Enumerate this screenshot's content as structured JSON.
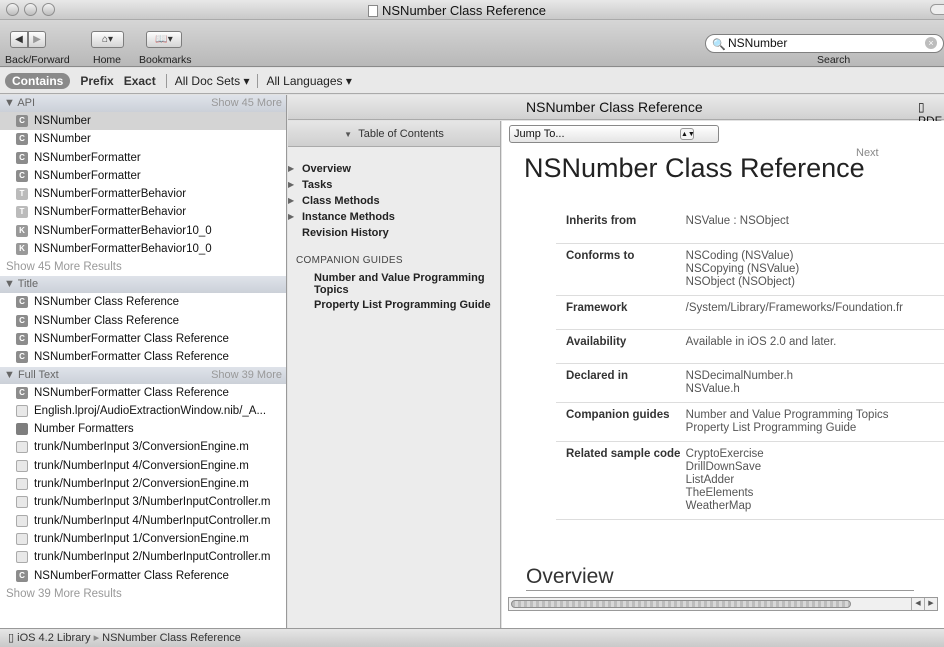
{
  "window": {
    "title": "NSNumber Class Reference"
  },
  "toolbar": {
    "back_forward_label": "Back/Forward",
    "home_label": "Home",
    "bookmarks_label": "Bookmarks",
    "search_value": "NSNumber",
    "search_label": "Search"
  },
  "filter": {
    "contains": "Contains",
    "prefix": "Prefix",
    "exact": "Exact",
    "doc_sets": "All Doc Sets",
    "languages": "All Languages"
  },
  "sidebar": {
    "api": {
      "header": "API",
      "more": "Show 45 More",
      "items": [
        {
          "icon": "C",
          "label": "NSNumber"
        },
        {
          "icon": "C",
          "label": "NSNumber"
        },
        {
          "icon": "C",
          "label": "NSNumberFormatter"
        },
        {
          "icon": "C",
          "label": "NSNumberFormatter"
        },
        {
          "icon": "T",
          "label": "NSNumberFormatterBehavior"
        },
        {
          "icon": "T",
          "label": "NSNumberFormatterBehavior"
        },
        {
          "icon": "K",
          "label": "NSNumberFormatterBehavior10_0"
        },
        {
          "icon": "K",
          "label": "NSNumberFormatterBehavior10_0"
        }
      ],
      "more_results": "Show 45 More Results"
    },
    "title": {
      "header": "Title",
      "items": [
        {
          "icon": "C",
          "label": "NSNumber Class Reference"
        },
        {
          "icon": "C",
          "label": "NSNumber Class Reference"
        },
        {
          "icon": "C",
          "label": "NSNumberFormatter Class Reference"
        },
        {
          "icon": "C",
          "label": "NSNumberFormatter Class Reference"
        }
      ]
    },
    "fulltext": {
      "header": "Full Text",
      "more": "Show 39 More",
      "items": [
        {
          "icon": "C",
          "label": "NSNumberFormatter Class Reference"
        },
        {
          "icon": "F",
          "label": "English.lproj/AudioExtractionWindow.nib/_A..."
        },
        {
          "icon": "B",
          "label": "Number Formatters"
        },
        {
          "icon": "F",
          "label": "trunk/NumberInput 3/ConversionEngine.m"
        },
        {
          "icon": "F",
          "label": "trunk/NumberInput 4/ConversionEngine.m"
        },
        {
          "icon": "F",
          "label": "trunk/NumberInput 2/ConversionEngine.m"
        },
        {
          "icon": "F",
          "label": "trunk/NumberInput 3/NumberInputController.m"
        },
        {
          "icon": "F",
          "label": "trunk/NumberInput 4/NumberInputController.m"
        },
        {
          "icon": "F",
          "label": "trunk/NumberInput 1/ConversionEngine.m"
        },
        {
          "icon": "F",
          "label": "trunk/NumberInput 2/NumberInputController.m"
        },
        {
          "icon": "C",
          "label": "NSNumberFormatter Class Reference"
        }
      ],
      "more_results": "Show 39 More Results"
    }
  },
  "doc": {
    "bar_title": "NSNumber Class Reference",
    "pdf_label": "PDF",
    "jump_to": "Jump To...",
    "title": "NSNumber Class Reference",
    "next": "Next",
    "overview": "Overview",
    "properties": [
      {
        "key": "Inherits from",
        "lines": [
          "NSValue : NSObject"
        ]
      },
      {
        "key": "Conforms to",
        "lines": [
          "NSCoding (NSValue)",
          "NSCopying (NSValue)",
          "NSObject (NSObject)"
        ]
      },
      {
        "key": "Framework",
        "lines": [
          "/System/Library/Frameworks/Foundation.fr"
        ]
      },
      {
        "key": "Availability",
        "lines": [
          "Available in iOS 2.0 and later."
        ]
      },
      {
        "key": "Declared in",
        "lines": [
          "NSDecimalNumber.h",
          "NSValue.h"
        ]
      },
      {
        "key": "Companion guides",
        "lines": [
          "Number and Value Programming Topics",
          "Property List Programming Guide"
        ]
      },
      {
        "key": "Related sample code",
        "lines": [
          "CryptoExercise",
          "DrillDownSave",
          "ListAdder",
          "TheElements",
          "WeatherMap"
        ]
      }
    ]
  },
  "toc": {
    "header": "Table of Contents",
    "items": [
      {
        "label": "Overview",
        "expandable": true
      },
      {
        "label": "Tasks",
        "expandable": true
      },
      {
        "label": "Class Methods",
        "expandable": true
      },
      {
        "label": "Instance Methods",
        "expandable": true
      },
      {
        "label": "Revision History",
        "expandable": false
      }
    ],
    "companion_header": "COMPANION GUIDES",
    "companion_items": [
      "Number and Value Programming Topics",
      "Property List Programming Guide"
    ]
  },
  "status": {
    "library": "iOS 4.2 Library",
    "page": "NSNumber Class Reference"
  }
}
